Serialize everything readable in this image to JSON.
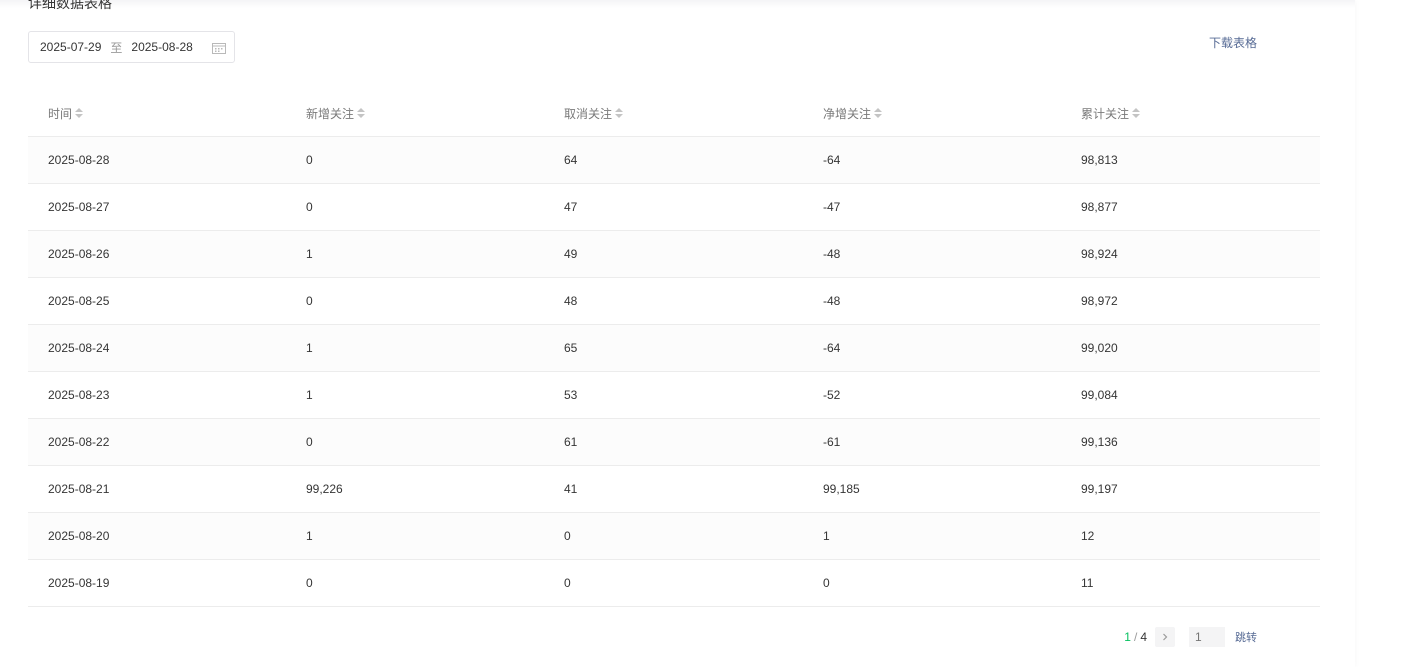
{
  "section": {
    "title": "详细数据表格"
  },
  "date_range": {
    "start": "2025-07-29",
    "separator": "至",
    "end": "2025-08-28"
  },
  "toolbar": {
    "download_label": "下载表格"
  },
  "table": {
    "columns": [
      "时间",
      "新增关注",
      "取消关注",
      "净增关注",
      "累计关注"
    ],
    "rows": [
      [
        "2025-08-28",
        "0",
        "64",
        "-64",
        "98,813"
      ],
      [
        "2025-08-27",
        "0",
        "47",
        "-47",
        "98,877"
      ],
      [
        "2025-08-26",
        "1",
        "49",
        "-48",
        "98,924"
      ],
      [
        "2025-08-25",
        "0",
        "48",
        "-48",
        "98,972"
      ],
      [
        "2025-08-24",
        "1",
        "65",
        "-64",
        "99,020"
      ],
      [
        "2025-08-23",
        "1",
        "53",
        "-52",
        "99,084"
      ],
      [
        "2025-08-22",
        "0",
        "61",
        "-61",
        "99,136"
      ],
      [
        "2025-08-21",
        "99,226",
        "41",
        "99,185",
        "99,197"
      ],
      [
        "2025-08-20",
        "1",
        "0",
        "1",
        "12"
      ],
      [
        "2025-08-19",
        "0",
        "0",
        "0",
        "11"
      ]
    ]
  },
  "pagination": {
    "current": "1",
    "separator": "/",
    "total": "4",
    "input_placeholder": "1",
    "jump_label": "跳转"
  },
  "icons": {
    "calendar": "calendar-icon",
    "sort": "sort-icon",
    "next": "chevron-right-icon"
  },
  "colors": {
    "accent": "#07c160",
    "link": "#576b95",
    "border": "#ececec"
  }
}
